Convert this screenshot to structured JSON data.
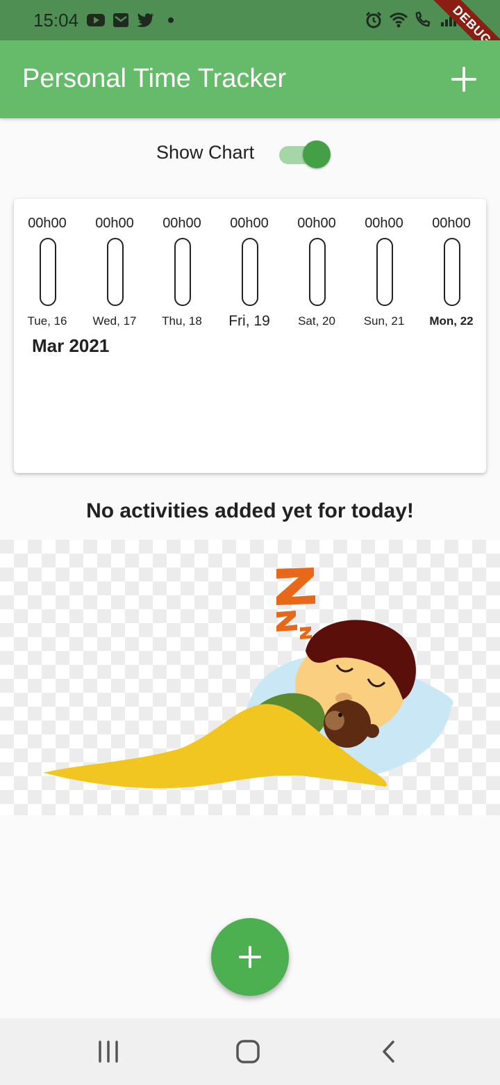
{
  "status_bar": {
    "time": "15:04",
    "left_icons": [
      "youtube-icon",
      "mail-icon",
      "twitter-icon",
      "dot-icon"
    ],
    "right_icons": [
      "alarm-icon",
      "wifi-icon",
      "wifi-calling-icon",
      "signal-icon"
    ],
    "debug_label": "DEBUG",
    "color": "#4f8f53"
  },
  "app_bar": {
    "title": "Personal Time Tracker",
    "add_icon": "plus-icon",
    "color": "#66bb6a"
  },
  "chart_toggle": {
    "label": "Show Chart",
    "on": true
  },
  "week_chart": {
    "days": [
      {
        "hours": "00h00",
        "label": "Tue, 16",
        "fill": 0
      },
      {
        "hours": "00h00",
        "label": "Wed, 17",
        "fill": 0
      },
      {
        "hours": "00h00",
        "label": "Thu, 18",
        "fill": 0
      },
      {
        "hours": "00h00",
        "label": "Fri, 19",
        "fill": 0
      },
      {
        "hours": "00h00",
        "label": "Sat, 20",
        "fill": 0
      },
      {
        "hours": "00h00",
        "label": "Sun, 21",
        "fill": 0
      },
      {
        "hours": "00h00",
        "label": "Mon, 22",
        "fill": 0
      }
    ],
    "month": "Mar 2021"
  },
  "empty_state": {
    "message": "No activities added yet for today!",
    "image": "sleeping-child-illustration"
  },
  "fab": {
    "icon": "plus-icon",
    "color": "#4caf50"
  },
  "nav_bar": {
    "icons": [
      "recent-apps-icon",
      "home-icon",
      "back-icon"
    ]
  }
}
